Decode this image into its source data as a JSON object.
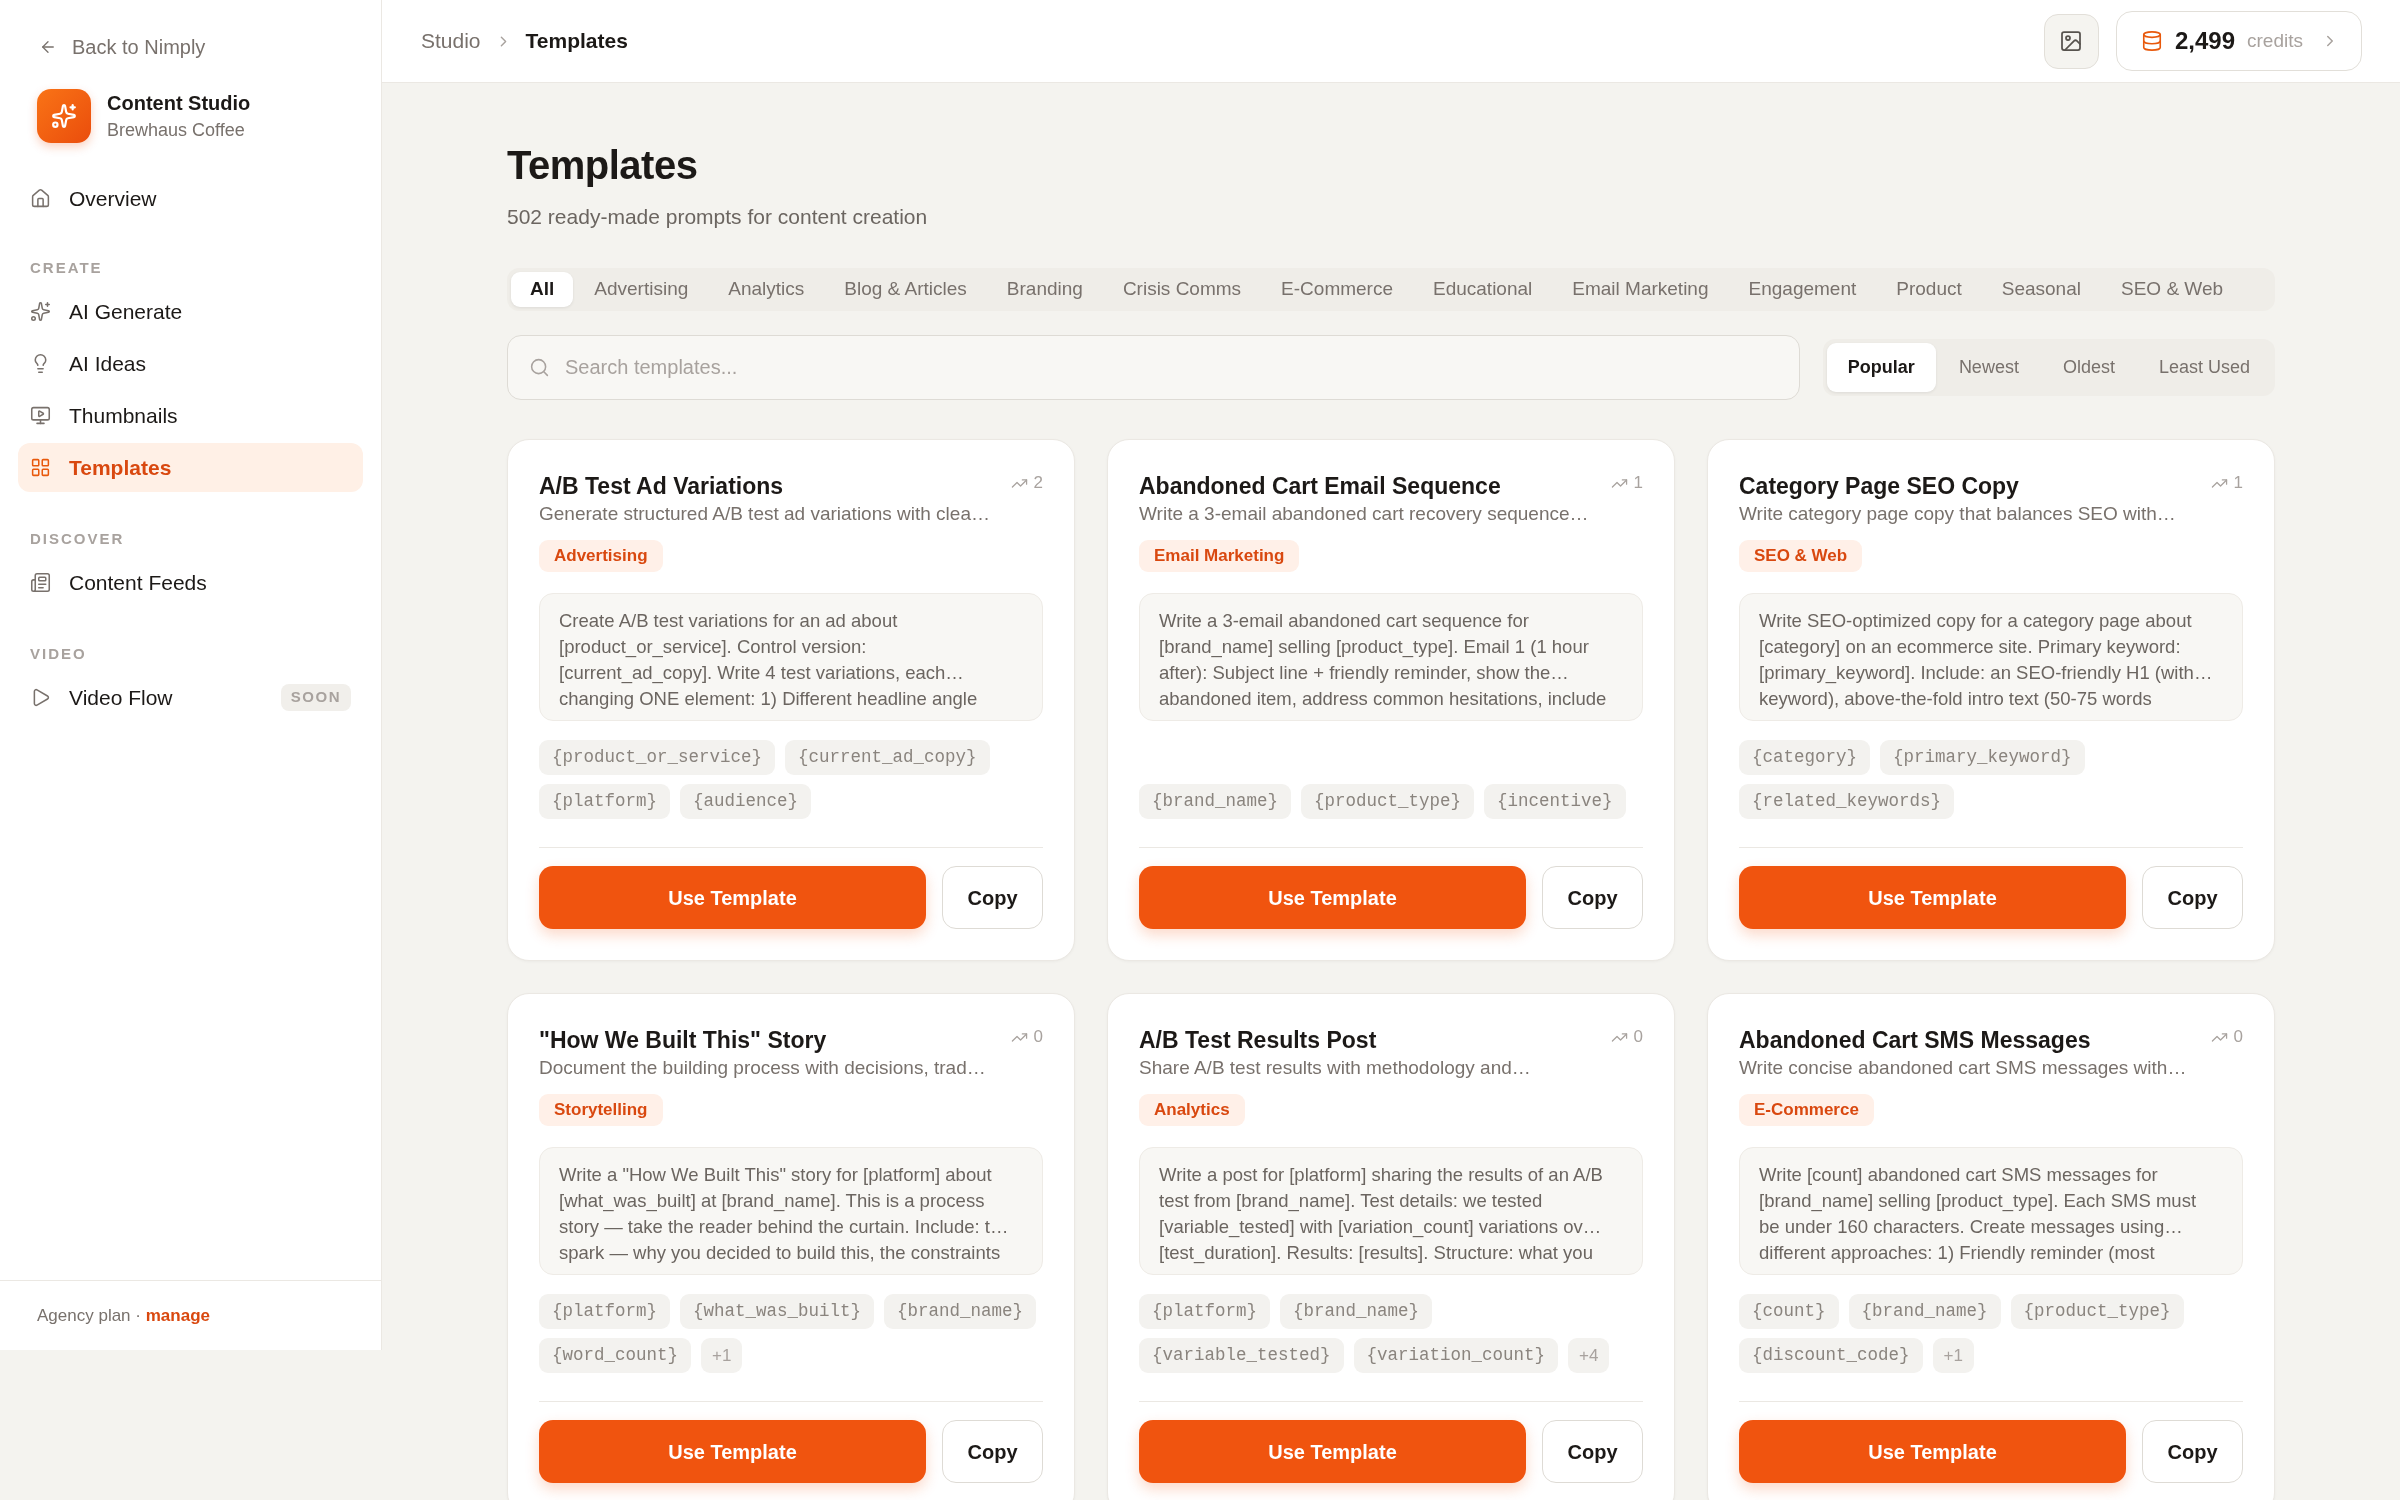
{
  "sidebar": {
    "back_link": "Back to Nimply",
    "app_name": "Content Studio",
    "workspace": "Brewhaus Coffee",
    "sections": [
      {
        "items": [
          {
            "label": "Overview",
            "selected": false
          }
        ]
      },
      {
        "title": "CREATE",
        "items": [
          {
            "label": "AI Generate",
            "selected": false
          },
          {
            "label": "AI Ideas",
            "selected": false
          },
          {
            "label": "Thumbnails",
            "selected": false
          },
          {
            "label": "Templates",
            "selected": true
          }
        ]
      },
      {
        "title": "DISCOVER",
        "items": [
          {
            "label": "Content Feeds",
            "selected": false
          }
        ]
      },
      {
        "title": "VIDEO",
        "items": [
          {
            "label": "Video Flow",
            "selected": false,
            "badge": "SOON"
          }
        ]
      }
    ],
    "footer": {
      "plan": "Agency plan",
      "separator": "·",
      "link": "manage"
    }
  },
  "header": {
    "breadcrumb": [
      "Studio",
      "Templates"
    ],
    "credits": {
      "amount": "2,499",
      "unit": "credits"
    }
  },
  "page": {
    "title": "Templates",
    "subtitle": "502 ready-made prompts for content creation"
  },
  "category_tabs": [
    {
      "label": "All",
      "selected": true
    },
    {
      "label": "Advertising",
      "selected": false
    },
    {
      "label": "Analytics",
      "selected": false
    },
    {
      "label": "Blog & Articles",
      "selected": false
    },
    {
      "label": "Branding",
      "selected": false
    },
    {
      "label": "Crisis Comms",
      "selected": false
    },
    {
      "label": "E-Commerce",
      "selected": false
    },
    {
      "label": "Educational",
      "selected": false
    },
    {
      "label": "Email Marketing",
      "selected": false
    },
    {
      "label": "Engagement",
      "selected": false
    },
    {
      "label": "Product",
      "selected": false
    },
    {
      "label": "Seasonal",
      "selected": false
    },
    {
      "label": "SEO & Web",
      "selected": false
    }
  ],
  "search": {
    "placeholder": "Search templates..."
  },
  "sort_options": [
    {
      "label": "Popular",
      "selected": true
    },
    {
      "label": "Newest",
      "selected": false
    },
    {
      "label": "Oldest",
      "selected": false
    },
    {
      "label": "Least Used",
      "selected": false
    }
  ],
  "templates": [
    {
      "title": "A/B Test Ad Variations",
      "uses": "2",
      "description": "Generate structured A/B test ad variations with clea…",
      "category": "Advertising",
      "prompt": "Create A/B test variations for an ad about\n[product_or_service]. Control version:\n[current_ad_copy]. Write 4 test variations, each…\nchanging ONE element: 1) Different headline angle",
      "variable_rows": [
        [
          "{product_or_service}",
          "{current_ad_copy}"
        ],
        [
          "{platform}",
          "{audience}"
        ]
      ],
      "primary_action": "Use Template",
      "secondary_action": "Copy"
    },
    {
      "title": "Abandoned Cart Email Sequence",
      "uses": "1",
      "description": "Write a 3-email abandoned cart recovery sequence…",
      "category": "Email Marketing",
      "prompt": "Write a 3-email abandoned cart sequence for\n[brand_name] selling [product_type]. Email 1 (1 hour\nafter): Subject line + friendly reminder, show the…\nabandoned item, address common hesitations, include",
      "variable_rows": [
        [
          "{brand_name}",
          "{product_type}",
          "{incentive}"
        ]
      ],
      "primary_action": "Use Template",
      "secondary_action": "Copy"
    },
    {
      "title": "Category Page SEO Copy",
      "uses": "1",
      "description": "Write category page copy that balances SEO with…",
      "category": "SEO & Web",
      "prompt": "Write SEO-optimized copy for a category page about\n[category] on an ecommerce site. Primary keyword:\n[primary_keyword]. Include: an SEO-friendly H1 (with…\nkeyword), above-the-fold intro text (50-75 words",
      "variable_rows": [
        [
          "{category}",
          "{primary_keyword}"
        ],
        [
          "{related_keywords}"
        ]
      ],
      "primary_action": "Use Template",
      "secondary_action": "Copy"
    },
    {
      "title": "\"How We Built This\" Story",
      "uses": "0",
      "description": "Document the building process with decisions, trad…",
      "category": "Storytelling",
      "prompt": "Write a \"How We Built This\" story for [platform] about\n[what_was_built] at [brand_name]. This is a process\nstory — take the reader behind the curtain. Include: t…\nspark — why you decided to build this, the constraints",
      "variable_rows": [
        [
          "{platform}",
          "{what_was_built}",
          "{brand_name}"
        ],
        [
          "{word_count}"
        ]
      ],
      "more": "+1",
      "primary_action": "Use Template",
      "secondary_action": "Copy"
    },
    {
      "title": "A/B Test Results Post",
      "uses": "0",
      "description": "Share A/B test results with methodology and…",
      "category": "Analytics",
      "prompt": "Write a post for [platform] sharing the results of an A/B\ntest from [brand_name]. Test details: we tested\n[variable_tested] with [variation_count] variations ov…\n[test_duration]. Results: [results]. Structure: what you",
      "variable_rows": [
        [
          "{platform}",
          "{brand_name}"
        ],
        [
          "{variable_tested}",
          "{variation_count}"
        ]
      ],
      "more": "+4",
      "primary_action": "Use Template",
      "secondary_action": "Copy"
    },
    {
      "title": "Abandoned Cart SMS Messages",
      "uses": "0",
      "description": "Write concise abandoned cart SMS messages with…",
      "category": "E-Commerce",
      "prompt": "Write [count] abandoned cart SMS messages for\n[brand_name] selling [product_type]. Each SMS must\nbe under 160 characters. Create messages using…\ndifferent approaches: 1) Friendly reminder (most",
      "variable_rows": [
        [
          "{count}",
          "{brand_name}",
          "{product_type}"
        ],
        [
          "{discount_code}"
        ]
      ],
      "more": "+1",
      "primary_action": "Use Template",
      "secondary_action": "Copy"
    }
  ]
}
